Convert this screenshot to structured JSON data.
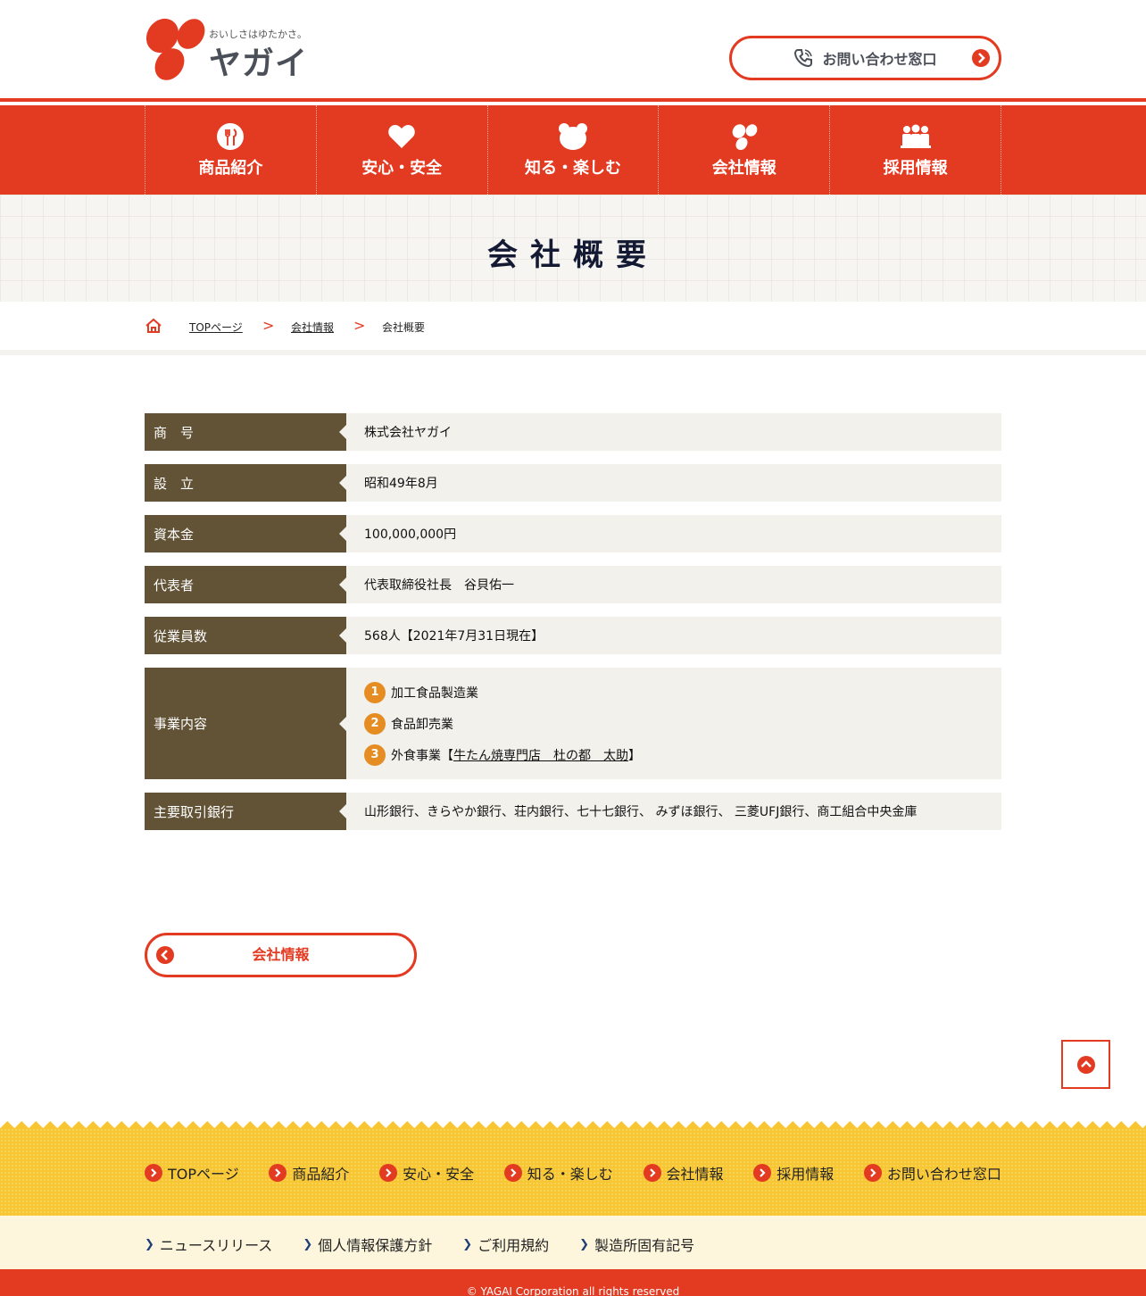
{
  "header": {
    "logo_tagline": "おいしさはゆたかさ。",
    "logo_name": "ヤガイ",
    "contact_label": "お問い合わせ窓口"
  },
  "nav": {
    "items": [
      {
        "label": "商品紹介",
        "icon": "fork-knife-icon"
      },
      {
        "label": "安心・安全",
        "icon": "heart-icon"
      },
      {
        "label": "知る・楽しむ",
        "icon": "bear-icon"
      },
      {
        "label": "会社情報",
        "icon": "bean-icon"
      },
      {
        "label": "採用情報",
        "icon": "people-icon"
      }
    ]
  },
  "page_title": "会社概要",
  "breadcrumb": {
    "home_icon": "home-icon",
    "items": [
      "TOPページ",
      "会社情報",
      "会社概要"
    ],
    "separator": ">"
  },
  "profile": {
    "rows": [
      {
        "label": "商　号",
        "value": "株式会社ヤガイ"
      },
      {
        "label": "設　立",
        "value": "昭和49年8月"
      },
      {
        "label": "資本金",
        "value": "100,000,000円"
      },
      {
        "label": "代表者",
        "value": "代表取締役社長　谷貝佑一"
      },
      {
        "label": "従業員数",
        "value": "568人【2021年7月31日現在】"
      },
      {
        "label": "事業内容",
        "items": [
          {
            "num": "1",
            "text": "加工食品製造業"
          },
          {
            "num": "2",
            "text": "食品卸売業"
          },
          {
            "num": "3",
            "text_before": "外食事業【",
            "link": "牛たん焼専門店　杜の都　太助",
            "text_after": "】"
          }
        ]
      },
      {
        "label": "主要取引銀行",
        "value": "山形銀行、きらやか銀行、荘内銀行、七十七銀行、 みずほ銀行、 三菱UFJ銀行、商工組合中央金庫"
      }
    ]
  },
  "back_button": {
    "label": "会社情報"
  },
  "footer": {
    "nav": [
      "TOPページ",
      "商品紹介",
      "安心・安全",
      "知る・楽しむ",
      "会社情報",
      "採用情報",
      "お問い合わせ窓口"
    ],
    "sub": [
      "ニュースリリース",
      "個人情報保護方針",
      "ご利用規約",
      "製造所固有記号"
    ],
    "copyright": "© YAGAI Corporation all rights reserved"
  },
  "colors": {
    "accent": "#e33a22",
    "label_bg": "#625336",
    "value_bg": "#f2f1ec",
    "footer_bg": "#f8c533",
    "number_badge": "#e58c23"
  }
}
